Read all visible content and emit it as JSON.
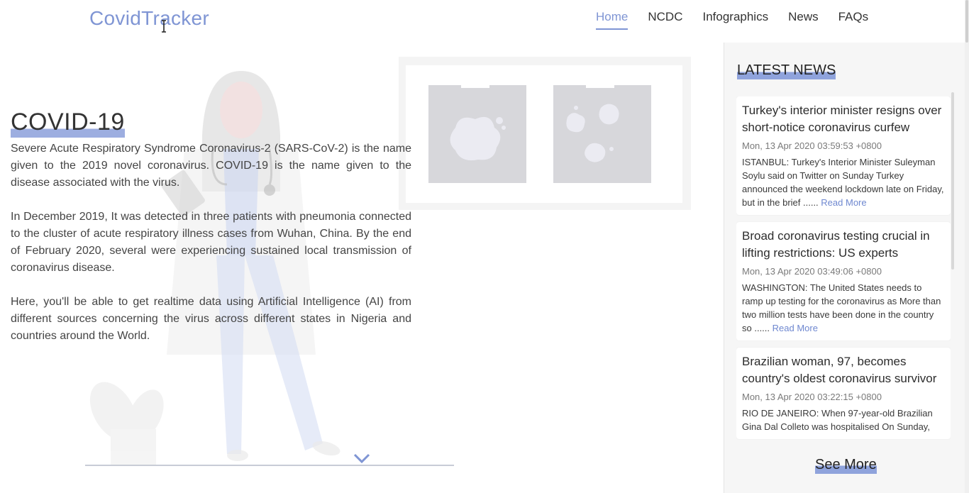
{
  "brand": "CovidTracker",
  "nav": [
    {
      "label": "Home",
      "active": true
    },
    {
      "label": "NCDC",
      "active": false
    },
    {
      "label": "Infographics",
      "active": false
    },
    {
      "label": "News",
      "active": false
    },
    {
      "label": "FAQs",
      "active": false
    }
  ],
  "intro": {
    "title": "COVID-19",
    "paragraphs": [
      "Severe Acute Respiratory Syndrome Coronavirus-2 (SARS-CoV-2) is the name given to the 2019 novel coronavirus. COVID-19 is the name given to the disease associated with the virus.",
      "In December 2019, It was detected in three patients with pneumonia connected to the cluster of acute respiratory illness cases from Wuhan, China. By the end of February 2020, several were experiencing sustained local transmission of coronavirus disease.",
      "Here, you'll be able to get realtime data using Artificial Intelligence (AI) from different sources concerning the virus across different states in Nigeria and countries around the World."
    ]
  },
  "sidebar": {
    "title": "LATEST NEWS",
    "see_more": "See More",
    "news": [
      {
        "headline": "Turkey's interior minister resigns over short-notice coronavirus curfew",
        "date": "Mon, 13 Apr 2020 03:59:53 +0800",
        "summary": "ISTANBUL: Turkey's Interior Minister Suleyman Soylu said on Twitter on Sunday Turkey announced the weekend lockdown late on Friday, but in the brief ......",
        "read_more": "Read More"
      },
      {
        "headline": "Broad coronavirus testing crucial in lifting restrictions: US experts",
        "date": "Mon, 13 Apr 2020 03:49:06 +0800",
        "summary": "WASHINGTON: The United States needs to ramp up testing for the coronavirus as More than two million tests have been done in the country so ......",
        "read_more": "Read More"
      },
      {
        "headline": "Brazilian woman, 97, becomes country's oldest coronavirus survivor",
        "date": "Mon, 13 Apr 2020 03:22:15 +0800",
        "summary": "RIO DE JANEIRO: When 97-year-old Brazilian Gina Dal Colleto was hospitalised On Sunday,",
        "read_more": ""
      }
    ]
  },
  "colors": {
    "accent": "#7f95d4",
    "highlight": "#9daee0",
    "sidebar_bg": "#f6f6f6"
  },
  "icons": {
    "scroll_down": "chevron-down-icon",
    "cursor": "text-cursor-icon"
  }
}
